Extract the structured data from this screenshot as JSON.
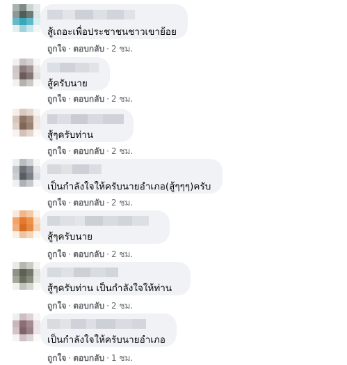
{
  "comments": [
    {
      "text": "สู้เถอะเพื่อประชาชนชาวเขาย้อย",
      "like": "ถูกใจ",
      "reply": "ตอบกลับ",
      "time": "2 ชม."
    },
    {
      "text": "สู้ครับนาย",
      "like": "ถูกใจ",
      "reply": "ตอบกลับ",
      "time": "2 ชม."
    },
    {
      "text": "สู้ๆครับท่าน",
      "like": "ถูกใจ",
      "reply": "ตอบกลับ",
      "time": "2 ชม."
    },
    {
      "text": "เป็นกำลังใจให้ครับนายอำเภอ(สู้ๆๆๆ)ครับ",
      "like": "ถูกใจ",
      "reply": "ตอบกลับ",
      "time": "2 ชม."
    },
    {
      "text": "สู้ๆครับนาย",
      "like": "ถูกใจ",
      "reply": "ตอบกลับ",
      "time": "2 ชม."
    },
    {
      "text": "สู้ๆครับท่าน เป็นกำลังใจให้ท่าน",
      "like": "ถูกใจ",
      "reply": "ตอบกลับ",
      "time": "2 ชม."
    },
    {
      "text": "เป็นกำลังใจให้ครับนายอำเภอ",
      "like": "ถูกใจ",
      "reply": "ตอบกลับ",
      "time": "1 ชม."
    }
  ],
  "separator": "·",
  "colors": {
    "bubble": "#f0f2f5",
    "text": "#050505",
    "meta": "#65676b"
  }
}
